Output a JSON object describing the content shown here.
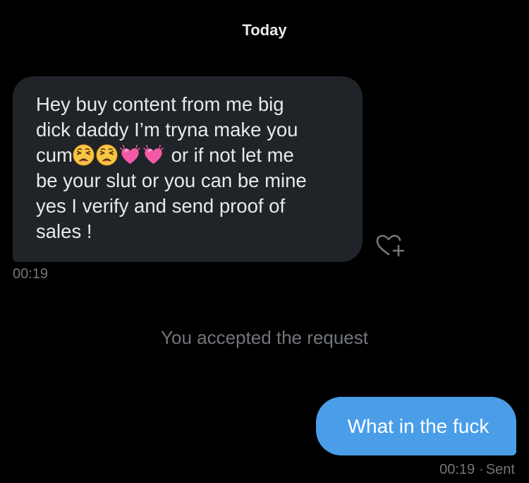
{
  "conversation": {
    "date_header": "Today"
  },
  "incoming_message": {
    "lines": [
      "Hey buy content from me big",
      "dick daddy I’m tryna  make you",
      "cum",
      "or if not let me",
      "be your slut or you can be mine",
      "yes I verify and send proof of",
      "sales !"
    ],
    "emojis": [
      "weary-face-emoji",
      "weary-face-emoji",
      "growing-heart-emoji",
      "growing-heart-emoji"
    ],
    "timestamp": "00:19",
    "react_icon": "heart-plus-icon"
  },
  "system_notice": "You accepted the request",
  "outgoing_message": {
    "text": "What in the fuck",
    "timestamp": "00:19",
    "separator": "·",
    "status": "Sent"
  },
  "colors": {
    "background": "#000000",
    "incoming_bubble": "#202327",
    "outgoing_bubble": "#4a9ee8",
    "primary_text": "#e7e9ea",
    "secondary_text": "#71767b"
  }
}
